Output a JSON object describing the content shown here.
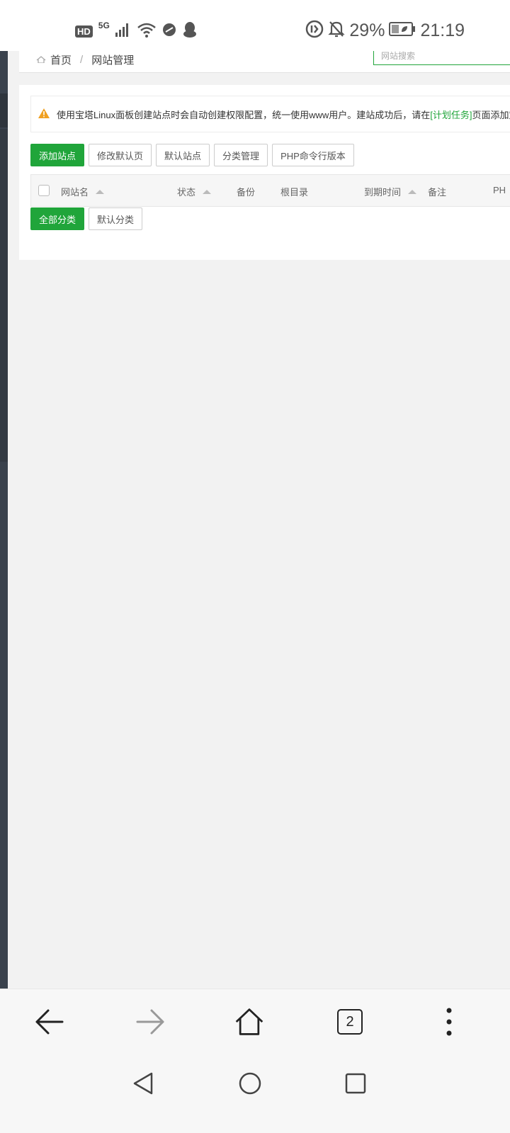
{
  "status_bar": {
    "hd": "HD",
    "network": "5G",
    "battery": "29%",
    "time": "21:19"
  },
  "breadcrumb": {
    "home": "首页",
    "separator": "/",
    "current": "网站管理",
    "search_placeholder": "网站搜索"
  },
  "alert": {
    "text_before": "使用宝塔Linux面板创建站点时会自动创建权限配置，统一使用www用户。建站成功后，请在",
    "link": "[计划任务]",
    "text_after": "页面添加定"
  },
  "toolbar": {
    "add_site": "添加站点",
    "edit_default_page": "修改默认页",
    "default_site": "默认站点",
    "category_manage": "分类管理",
    "php_cli_version": "PHP命令行版本"
  },
  "table": {
    "columns": {
      "site_name": "网站名",
      "status": "状态",
      "backup": "备份",
      "root_dir": "根目录",
      "expire_time": "到期时间",
      "remark": "备注",
      "php": "PH"
    }
  },
  "categories": {
    "all": "全部分类",
    "default": "默认分类"
  },
  "browser": {
    "tab_count": "2"
  },
  "colors": {
    "accent": "#20a53a",
    "sidebar": "#3a424d",
    "warning": "#f0a020"
  }
}
